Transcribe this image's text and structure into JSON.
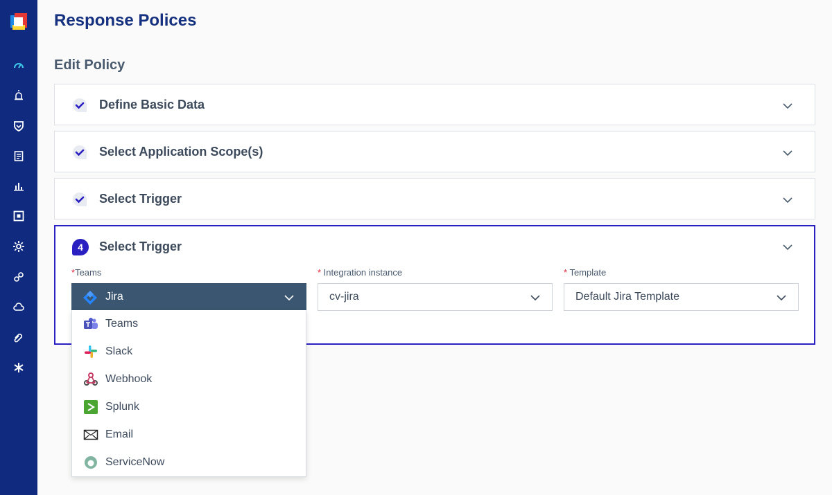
{
  "page": {
    "title": "Response Polices",
    "section_title": "Edit Policy"
  },
  "sidebar": {
    "items": [
      {
        "name": "dashboard-icon"
      },
      {
        "name": "alarm-icon"
      },
      {
        "name": "shield-icon"
      },
      {
        "name": "clipboard-icon"
      },
      {
        "name": "bar-chart-icon"
      },
      {
        "name": "box-icon"
      },
      {
        "name": "gear-icon"
      },
      {
        "name": "link-icon"
      },
      {
        "name": "cloud-icon"
      },
      {
        "name": "paperclip-icon"
      },
      {
        "name": "asterisk-icon"
      }
    ]
  },
  "steps": [
    {
      "label": "Define Basic Data",
      "state": "done"
    },
    {
      "label": "Select Application Scope(s)",
      "state": "done"
    },
    {
      "label": "Select Trigger",
      "state": "done"
    }
  ],
  "active_step": {
    "number": "4",
    "label": "Select Trigger",
    "fields": {
      "teams": {
        "required_mark": "*",
        "label": "Teams",
        "value": "Jira"
      },
      "integration": {
        "required_mark": "*",
        "label": " Integration instance",
        "value": "cv-jira"
      },
      "template": {
        "required_mark": "*",
        "label": " Template",
        "value": "Default Jira Template"
      }
    }
  },
  "teams_dropdown": {
    "options": [
      {
        "label": "Teams",
        "icon": "ms-teams-icon"
      },
      {
        "label": "Slack",
        "icon": "slack-icon"
      },
      {
        "label": "Webhook",
        "icon": "webhook-icon"
      },
      {
        "label": "Splunk",
        "icon": "splunk-icon"
      },
      {
        "label": "Email",
        "icon": "email-icon"
      },
      {
        "label": "ServiceNow",
        "icon": "servicenow-icon"
      }
    ]
  },
  "colors": {
    "sidebar": "#0f2a7e",
    "title": "#14307e",
    "accent": "#2a1fc0",
    "selected_select": "#3b5670",
    "required": "#e0233a"
  }
}
